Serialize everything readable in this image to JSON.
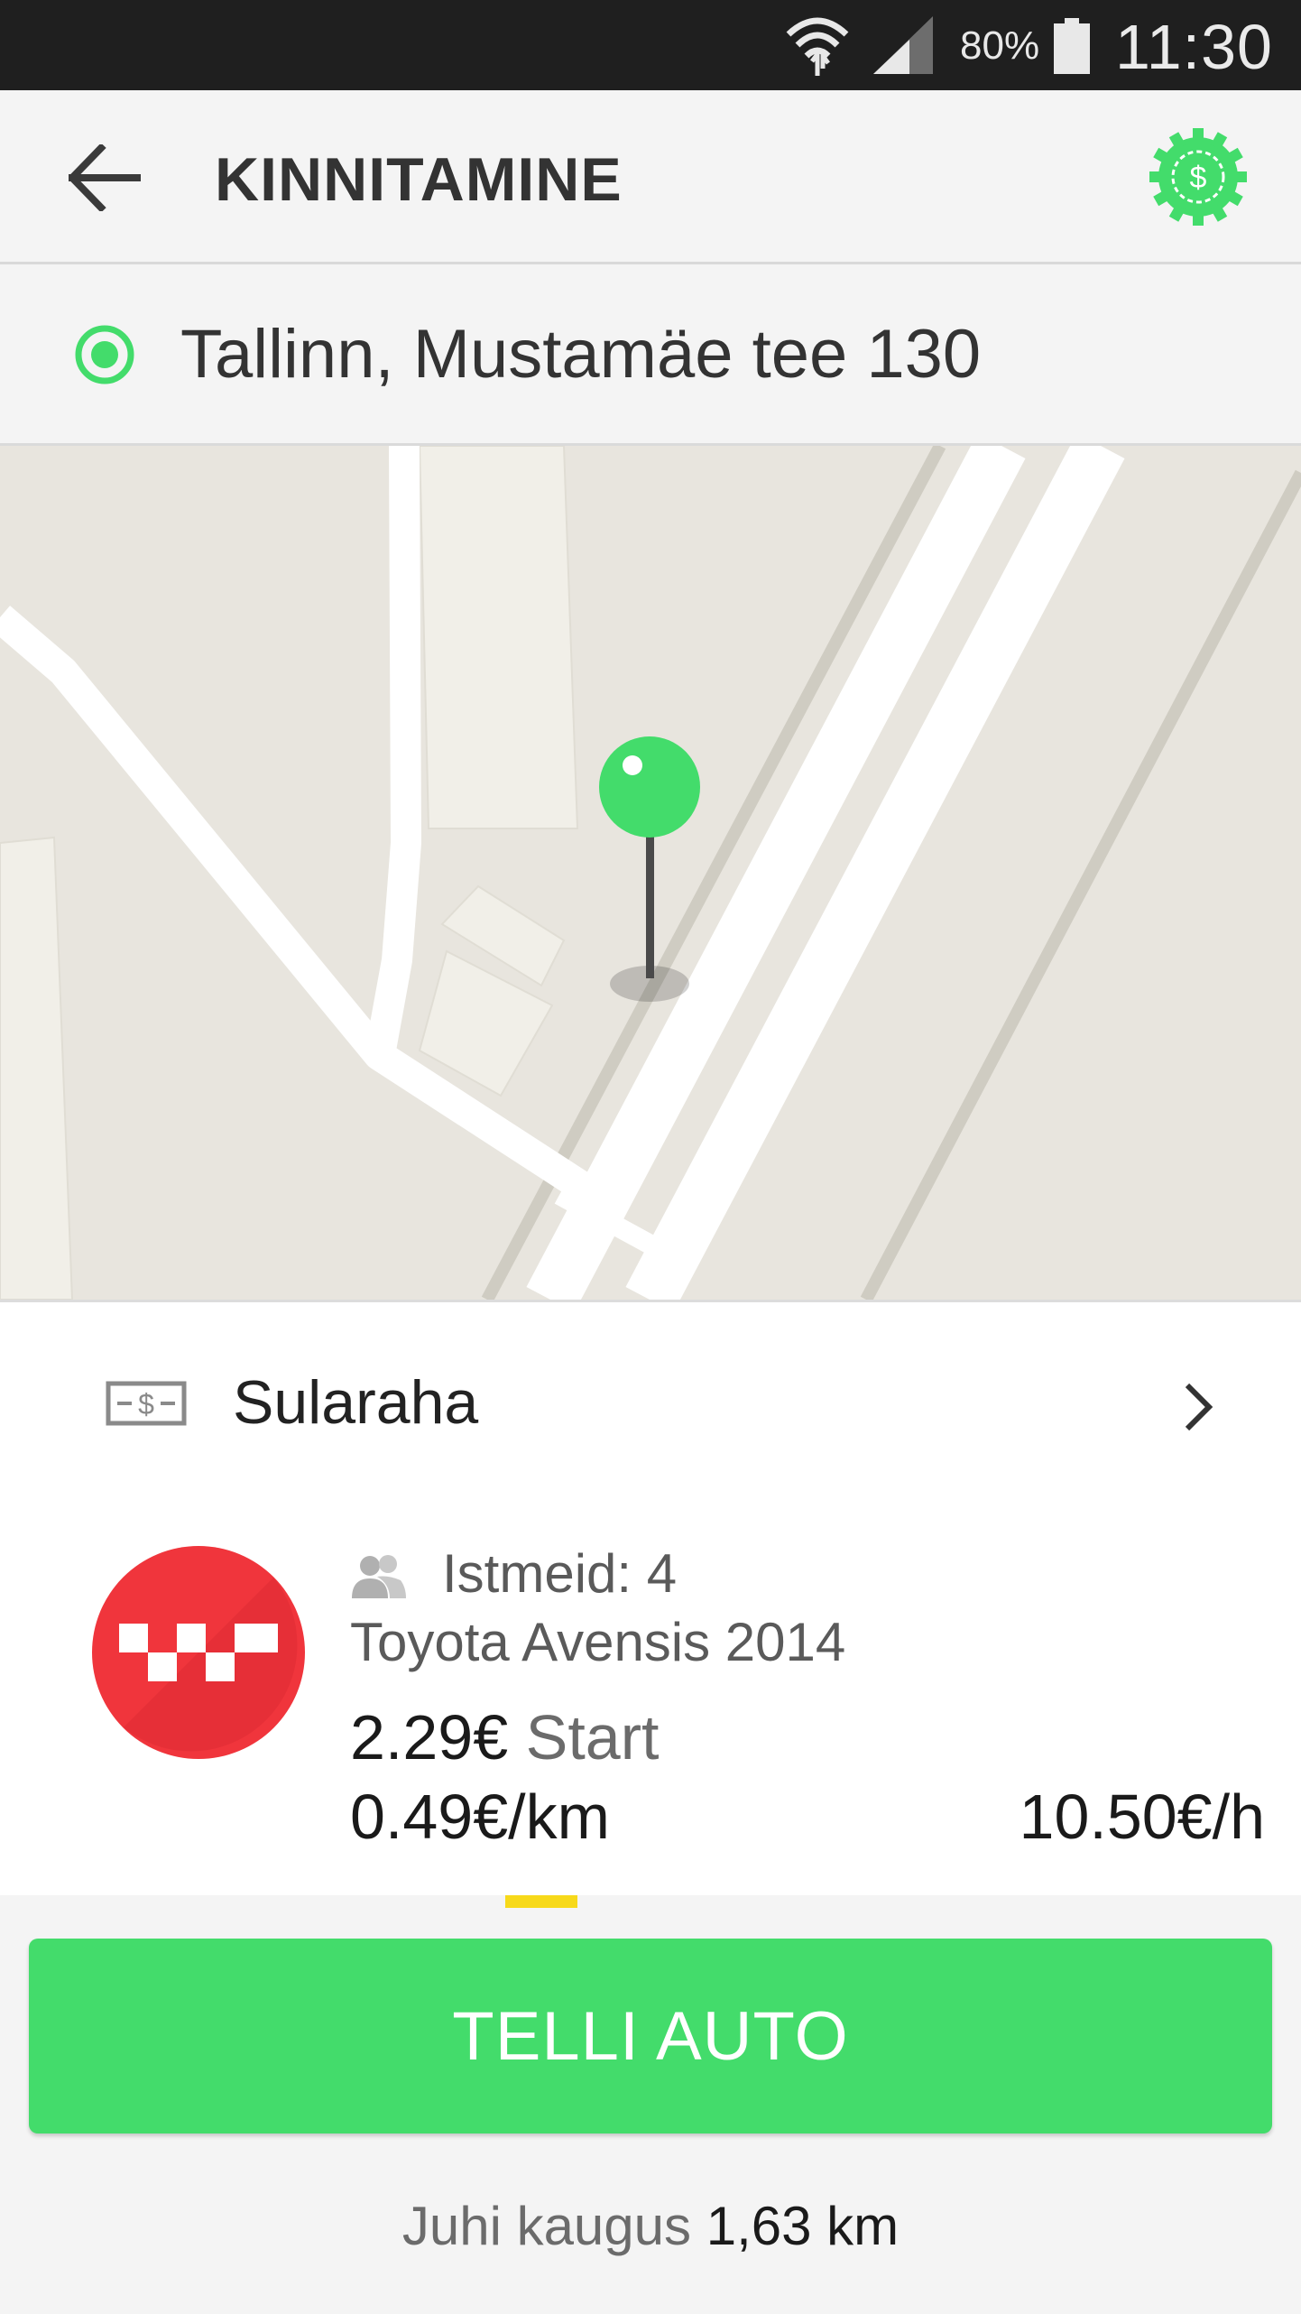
{
  "status_bar": {
    "battery_percent": "80%",
    "time": "11:30",
    "icons": [
      "wifi-icon",
      "signal-icon",
      "battery-icon"
    ]
  },
  "app_bar": {
    "title": "KINNITAMINE",
    "back_icon": "arrow-left-icon",
    "promo_icon": "dollar-badge-icon"
  },
  "pickup": {
    "address": "Tallinn, Mustamäe tee 130"
  },
  "map": {
    "marker": "green-pin"
  },
  "payment": {
    "method": "Sularaha",
    "icon": "cash-icon"
  },
  "car": {
    "seats_label": "Istmeid: 4",
    "model": "Toyota Avensis 2014",
    "start_price": "2.29€",
    "start_label": "Start",
    "price_per_km": "0.49€/km",
    "price_per_hour": "10.50€/h"
  },
  "order": {
    "button_label": "TELLI AUTO",
    "distance_label": "Juhi kaugus",
    "distance_value": "1,63 km"
  },
  "colors": {
    "accent_green": "#43dc6b",
    "taxi_red": "#f0353c",
    "indicator_yellow": "#f7d91a"
  }
}
